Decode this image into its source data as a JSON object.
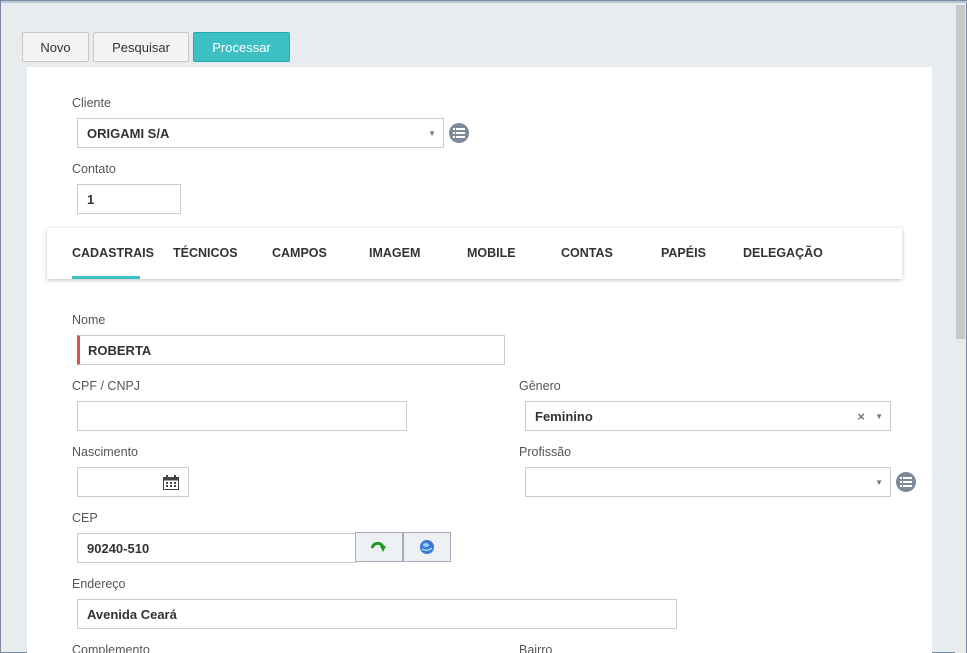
{
  "toolbar": {
    "novo_label": "Novo",
    "pesquisar_label": "Pesquisar",
    "processar_label": "Processar"
  },
  "cliente": {
    "label": "Cliente",
    "value": "ORIGAMI S/A"
  },
  "contato": {
    "label": "Contato",
    "value": "1"
  },
  "tabs": [
    {
      "label": "CADASTRAIS",
      "active": true
    },
    {
      "label": "TÉCNICOS"
    },
    {
      "label": "CAMPOS"
    },
    {
      "label": "IMAGEM"
    },
    {
      "label": "MOBILE"
    },
    {
      "label": "CONTAS"
    },
    {
      "label": "PAPÉIS"
    },
    {
      "label": "DELEGAÇÃO"
    }
  ],
  "form": {
    "nome": {
      "label": "Nome",
      "value": "ROBERTA"
    },
    "cpf": {
      "label": "CPF / CNPJ",
      "value": ""
    },
    "genero": {
      "label": "Gênero",
      "value": "Feminino"
    },
    "nascimento": {
      "label": "Nascimento",
      "value": ""
    },
    "profissao": {
      "label": "Profissão",
      "value": ""
    },
    "cep": {
      "label": "CEP",
      "value": "90240-510"
    },
    "endereco": {
      "label": "Endereço",
      "value": "Avenida Ceará"
    },
    "complemento": {
      "label": "Complemento"
    },
    "bairro": {
      "label": "Bairro"
    }
  },
  "colors": {
    "accent": "#3cc0c3",
    "required": "#d9534f"
  }
}
